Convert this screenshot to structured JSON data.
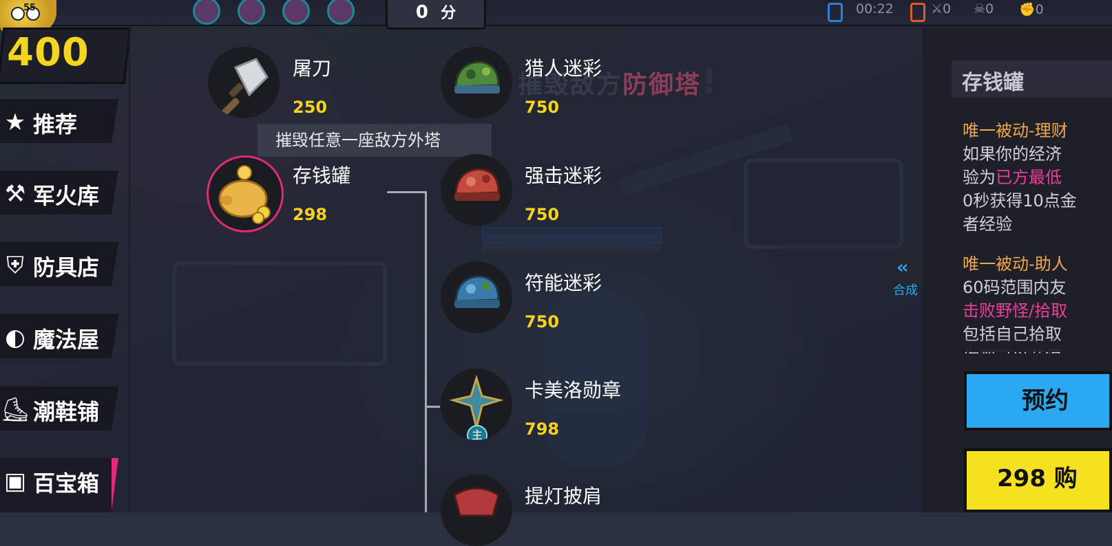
{
  "hud": {
    "score_value": "0",
    "score_unit": "分",
    "timer": "00:22",
    "kills": "0",
    "deaths": "0",
    "assists": "0",
    "mascot_badge": "55"
  },
  "gold": "400",
  "categories": [
    {
      "label": "推荐",
      "icon": "star-icon",
      "glyph": "★"
    },
    {
      "label": "军火库",
      "icon": "arsenal-icon",
      "glyph": "⚒"
    },
    {
      "label": "防具店",
      "icon": "shield-icon",
      "glyph": "⛨"
    },
    {
      "label": "魔法屋",
      "icon": "magic-orb-icon",
      "glyph": "◐"
    },
    {
      "label": "潮鞋铺",
      "icon": "shoe-icon",
      "glyph": "⛸"
    },
    {
      "label": "百宝箱",
      "icon": "treasure-chest-icon",
      "glyph": "▣"
    }
  ],
  "items_left": [
    {
      "name": "屠刀",
      "price": "250",
      "icon": "cleaver-icon"
    },
    {
      "name": "存钱罐",
      "price": "298",
      "icon": "piggy-bank-icon"
    }
  ],
  "items_right": [
    {
      "name": "猎人迷彩",
      "price": "750",
      "icon": "hunter-camo-cap-icon"
    },
    {
      "name": "强击迷彩",
      "price": "750",
      "icon": "strike-camo-cap-icon"
    },
    {
      "name": "符能迷彩",
      "price": "750",
      "icon": "rune-camo-cap-icon"
    },
    {
      "name": "卡美洛勋章",
      "price": "798",
      "icon": "camelot-medal-icon",
      "badge": "主"
    },
    {
      "name": "提灯披肩",
      "price": "",
      "icon": "lantern-shawl-icon"
    }
  ],
  "tooltip": "摧毁任意一座敌方外塔",
  "banner": {
    "part1": "摧毁敌方",
    "part2": "防御塔",
    "mark": "!"
  },
  "detail": {
    "title": "存钱罐",
    "passive1_title": "唯一被动-理财",
    "passive1_line1": "如果你的经济",
    "passive1_line2_a": "验为",
    "passive1_line2_b": "已方最低",
    "passive1_line3": "0秒获得10点金",
    "passive1_line4": "者经验",
    "passive2_title": "唯一被动-助人",
    "passive2_line1": "60码范围内友",
    "passive2_line2": "击败野怪/拾取",
    "passive2_line3": "包括自己拾取",
    "passive2_line4": "你都可以获得"
  },
  "synth_label": "合成",
  "buttons": {
    "reserve": "预约",
    "buy": "298 购"
  },
  "colors": {
    "gold": "#f6d51e",
    "price": "#f8d01e",
    "accent_pink": "#e12b77",
    "reserve_blue": "#2aa8f2",
    "buy_yellow": "#f5e11f"
  }
}
